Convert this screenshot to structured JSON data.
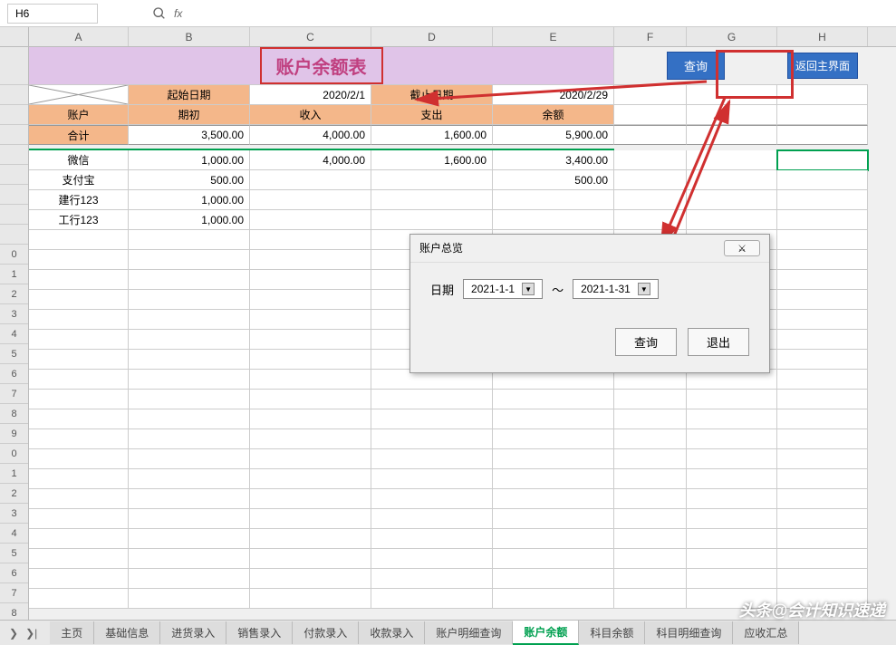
{
  "formula_bar": {
    "cell_ref": "H6",
    "fx_label": "fx"
  },
  "columns": [
    "A",
    "B",
    "C",
    "D",
    "E",
    "F",
    "G",
    "H"
  ],
  "title": "账户余额表",
  "buttons": {
    "query": "查询",
    "return_main": "返回主界面"
  },
  "date_labels": {
    "start": "起始日期",
    "end": "截止日期"
  },
  "date_values": {
    "start": "2020/2/1",
    "end": "2020/2/29"
  },
  "col_headers": {
    "account": "账户",
    "initial": "期初",
    "income": "收入",
    "expense": "支出",
    "balance": "余额"
  },
  "sum_label": "合计",
  "sum_row": {
    "initial": "3,500.00",
    "income": "4,000.00",
    "expense": "1,600.00",
    "balance": "5,900.00"
  },
  "accounts": [
    {
      "name": "微信",
      "initial": "1,000.00",
      "income": "4,000.00",
      "expense": "1,600.00",
      "balance": "3,400.00"
    },
    {
      "name": "支付宝",
      "initial": "500.00",
      "income": "",
      "expense": "",
      "balance": "500.00"
    },
    {
      "name": "建行123",
      "initial": "1,000.00",
      "income": "",
      "expense": "",
      "balance": ""
    },
    {
      "name": "工行123",
      "initial": "1,000.00",
      "income": "",
      "expense": "",
      "balance": ""
    }
  ],
  "dialog": {
    "title": "账户总览",
    "date_label": "日期",
    "start": "2021-1-1",
    "sep": "～",
    "end": "2021-1-31",
    "btn_query": "查询",
    "btn_exit": "退出",
    "close_glyph": "⚔"
  },
  "sheet_tabs": [
    "主页",
    "基础信息",
    "进货录入",
    "销售录入",
    "付款录入",
    "收款录入",
    "账户明细查询",
    "账户余额",
    "科目余额",
    "科目明细查询",
    "应收汇总"
  ],
  "active_tab": "账户余额",
  "watermark": "头条@会计知识速递"
}
